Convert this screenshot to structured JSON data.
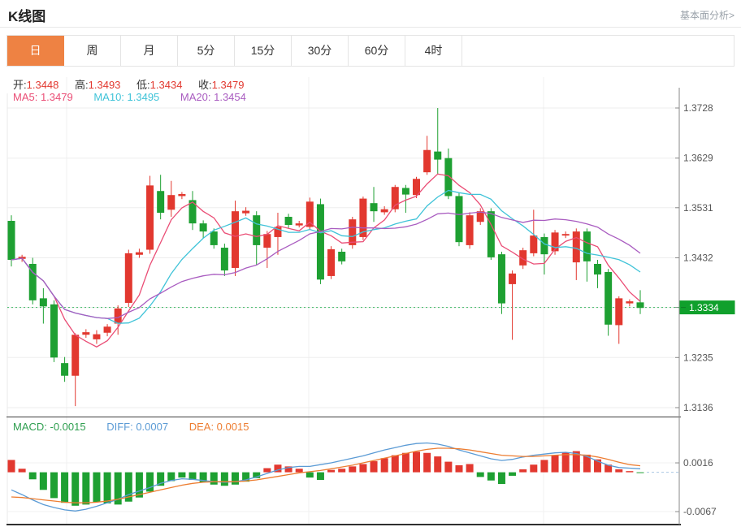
{
  "header": {
    "title": "K线图",
    "analysis_link": "基本面分析>"
  },
  "tabs": [
    {
      "label": "日",
      "active": true
    },
    {
      "label": "周",
      "active": false
    },
    {
      "label": "月",
      "active": false
    },
    {
      "label": "5分",
      "active": false
    },
    {
      "label": "15分",
      "active": false
    },
    {
      "label": "30分",
      "active": false
    },
    {
      "label": "60分",
      "active": false
    },
    {
      "label": "4时",
      "active": false
    }
  ],
  "ohlc_legend": {
    "open_label": "开:",
    "open_value": "1.3448",
    "high_label": "高:",
    "high_value": "1.3493",
    "low_label": "低:",
    "low_value": "1.3434",
    "close_label": "收:",
    "close_value": "1.3479"
  },
  "ma_legend": {
    "ma5": "MA5: 1.3479",
    "ma10": "MA10: 1.3495",
    "ma20": "MA20: 1.3454"
  },
  "macd_legend": {
    "macd": "MACD: -0.0015",
    "diff": "DIFF: 0.0007",
    "dea": "DEA: 0.0015"
  },
  "colors": {
    "up": "#e2382f",
    "down": "#1ea032",
    "ma5": "#ea4d75",
    "ma10": "#3fc3d8",
    "ma20": "#a95cc0",
    "diff_line": "#5b9bd5",
    "dea_line": "#ed7d31",
    "current_price_line": "#3cb963",
    "current_price_badge": "#10a02c",
    "tab_active_bg": "#ee8243",
    "grid": "#ededed",
    "axis": "#8a8a8a",
    "tick_text": "#555555"
  },
  "chart_data": [
    {
      "type": "candlestick",
      "panel": "main",
      "title": "K线图 (daily)",
      "legend": [
        "MA5",
        "MA10",
        "MA20"
      ],
      "ma_periods": [
        5,
        10,
        20
      ],
      "y_ticks": [
        "1.3728",
        "1.3629",
        "1.3531",
        "1.3432",
        "1.3334",
        "1.3235",
        "1.3136"
      ],
      "ylim": [
        1.312,
        1.3757
      ],
      "current_price": 1.3334,
      "current_price_label": "1.3334",
      "grid": true,
      "candles": [
        [
          1.3505,
          1.3516,
          1.3415,
          1.3428
        ],
        [
          1.343,
          1.3438,
          1.3424,
          1.3434
        ],
        [
          1.342,
          1.3432,
          1.334,
          1.3348
        ],
        [
          1.3352,
          1.3372,
          1.3302,
          1.3336
        ],
        [
          1.334,
          1.3348,
          1.3226,
          1.3235
        ],
        [
          1.3224,
          1.3236,
          1.3187,
          1.3199
        ],
        [
          1.3199,
          1.3283,
          1.3139,
          1.328
        ],
        [
          1.328,
          1.3291,
          1.3274,
          1.3285
        ],
        [
          1.3271,
          1.3289,
          1.3262,
          1.3281
        ],
        [
          1.3284,
          1.3301,
          1.3277,
          1.3296
        ],
        [
          1.3302,
          1.3338,
          1.328,
          1.3332
        ],
        [
          1.3343,
          1.3448,
          1.3335,
          1.3441
        ],
        [
          1.3438,
          1.345,
          1.3432,
          1.3443
        ],
        [
          1.3448,
          1.3594,
          1.344,
          1.3575
        ],
        [
          1.3564,
          1.3596,
          1.3508,
          1.3521
        ],
        [
          1.3527,
          1.3584,
          1.3513,
          1.3556
        ],
        [
          1.3554,
          1.3562,
          1.3548,
          1.3558
        ],
        [
          1.3546,
          1.3564,
          1.3487,
          1.35
        ],
        [
          1.35,
          1.3506,
          1.3471,
          1.3484
        ],
        [
          1.3484,
          1.349,
          1.345,
          1.3457
        ],
        [
          1.3452,
          1.346,
          1.3396,
          1.3407
        ],
        [
          1.3412,
          1.3545,
          1.3396,
          1.3524
        ],
        [
          1.352,
          1.3532,
          1.3515,
          1.3525
        ],
        [
          1.3516,
          1.3524,
          1.3417,
          1.3457
        ],
        [
          1.3452,
          1.3485,
          1.3412,
          1.3479
        ],
        [
          1.3473,
          1.3521,
          1.3438,
          1.3493
        ],
        [
          1.3513,
          1.3519,
          1.3491,
          1.3497
        ],
        [
          1.3496,
          1.3505,
          1.3492,
          1.35
        ],
        [
          1.3493,
          1.3551,
          1.3487,
          1.3543
        ],
        [
          1.3538,
          1.3549,
          1.338,
          1.3389
        ],
        [
          1.3396,
          1.3455,
          1.339,
          1.3449
        ],
        [
          1.3444,
          1.345,
          1.3419,
          1.3425
        ],
        [
          1.3457,
          1.3513,
          1.345,
          1.3508
        ],
        [
          1.3473,
          1.3553,
          1.3467,
          1.3549
        ],
        [
          1.354,
          1.3572,
          1.3503,
          1.3524
        ],
        [
          1.3522,
          1.3534,
          1.3517,
          1.3528
        ],
        [
          1.3528,
          1.3576,
          1.3522,
          1.3572
        ],
        [
          1.357,
          1.3576,
          1.3521,
          1.3557
        ],
        [
          1.3556,
          1.3592,
          1.355,
          1.3588
        ],
        [
          1.3601,
          1.3673,
          1.3596,
          1.3645
        ],
        [
          1.3642,
          1.3728,
          1.3598,
          1.3626
        ],
        [
          1.3629,
          1.3648,
          1.3548,
          1.3554
        ],
        [
          1.3554,
          1.356,
          1.3455,
          1.3463
        ],
        [
          1.3457,
          1.3522,
          1.345,
          1.3516
        ],
        [
          1.3503,
          1.353,
          1.3497,
          1.3524
        ],
        [
          1.3524,
          1.353,
          1.3428,
          1.3433
        ],
        [
          1.3439,
          1.3444,
          1.3321,
          1.3342
        ],
        [
          1.338,
          1.3407,
          1.327,
          1.3401
        ],
        [
          1.3417,
          1.3452,
          1.341,
          1.3447
        ],
        [
          1.3441,
          1.3527,
          1.3435,
          1.3476
        ],
        [
          1.3473,
          1.348,
          1.3399,
          1.3439
        ],
        [
          1.3445,
          1.3487,
          1.3438,
          1.3482
        ],
        [
          1.3476,
          1.3484,
          1.3471,
          1.3479
        ],
        [
          1.3423,
          1.349,
          1.3388,
          1.3484
        ],
        [
          1.3484,
          1.349,
          1.3385,
          1.3425
        ],
        [
          1.342,
          1.3428,
          1.3372,
          1.3399
        ],
        [
          1.3404,
          1.341,
          1.3278,
          1.33
        ],
        [
          1.3299,
          1.3356,
          1.3262,
          1.3352
        ],
        [
          1.3342,
          1.335,
          1.3336,
          1.3346
        ],
        [
          1.3344,
          1.3368,
          1.3321,
          1.3333
        ]
      ]
    },
    {
      "type": "bar",
      "panel": "macd",
      "title": "MACD(12,26,9)",
      "y_ticks": [
        "0.0016",
        "-0.0067"
      ],
      "grid": true,
      "bars": [
        0.0021,
        0.0006,
        -0.0012,
        -0.003,
        -0.0044,
        -0.0052,
        -0.0057,
        -0.0055,
        -0.0051,
        -0.0053,
        -0.0055,
        -0.005,
        -0.0043,
        -0.0033,
        -0.0023,
        -0.0015,
        -0.0009,
        -0.0013,
        -0.0017,
        -0.0021,
        -0.0023,
        -0.0021,
        -0.0016,
        -0.001,
        0.0007,
        0.0013,
        0.001,
        0.0006,
        -0.0009,
        -0.0013,
        0.0004,
        0.0006,
        0.001,
        0.0014,
        0.0019,
        0.0024,
        0.0029,
        0.0033,
        0.0035,
        0.0033,
        0.0027,
        0.0018,
        0.0012,
        0.0014,
        -0.0008,
        -0.0014,
        -0.002,
        -0.0006,
        0.0005,
        0.0013,
        0.0021,
        0.0029,
        0.0034,
        0.0036,
        0.003,
        0.0022,
        0.0013,
        0.0005,
        0.0002,
        -0.0001
      ],
      "diff": [
        -0.003,
        -0.0038,
        -0.0047,
        -0.0055,
        -0.006,
        -0.0064,
        -0.0066,
        -0.0063,
        -0.0058,
        -0.0052,
        -0.0046,
        -0.0038,
        -0.0032,
        -0.0026,
        -0.0019,
        -0.0014,
        -0.0011,
        -0.0012,
        -0.0014,
        -0.0016,
        -0.0017,
        -0.0016,
        -0.0013,
        -0.0008,
        -0.0002,
        0.0004,
        0.0008,
        0.001,
        0.001,
        0.0013,
        0.0016,
        0.002,
        0.0024,
        0.0028,
        0.0033,
        0.0038,
        0.0042,
        0.0046,
        0.0049,
        0.005,
        0.0048,
        0.0044,
        0.0038,
        0.0033,
        0.0028,
        0.0023,
        0.002,
        0.0022,
        0.0026,
        0.0029,
        0.0031,
        0.0033,
        0.0034,
        0.0032,
        0.0027,
        0.0019,
        0.0012,
        0.0008,
        0.0007,
        0.0006
      ],
      "dea": [
        -0.0042,
        -0.0043,
        -0.0045,
        -0.0047,
        -0.0049,
        -0.0051,
        -0.0052,
        -0.0052,
        -0.0051,
        -0.0049,
        -0.0046,
        -0.0042,
        -0.0038,
        -0.0034,
        -0.003,
        -0.0026,
        -0.0022,
        -0.0019,
        -0.0017,
        -0.0016,
        -0.0016,
        -0.0016,
        -0.0015,
        -0.0013,
        -0.001,
        -0.0007,
        -0.0004,
        -0.0001,
        0.0001,
        0.0003,
        0.0006,
        0.0009,
        0.0012,
        0.0016,
        0.002,
        0.0024,
        0.0028,
        0.0032,
        0.0036,
        0.0039,
        0.0041,
        0.0041,
        0.004,
        0.0038,
        0.0035,
        0.0032,
        0.0029,
        0.0028,
        0.0027,
        0.0027,
        0.0028,
        0.0029,
        0.003,
        0.003,
        0.0029,
        0.0026,
        0.0022,
        0.0017,
        0.0013,
        0.0011
      ]
    }
  ]
}
